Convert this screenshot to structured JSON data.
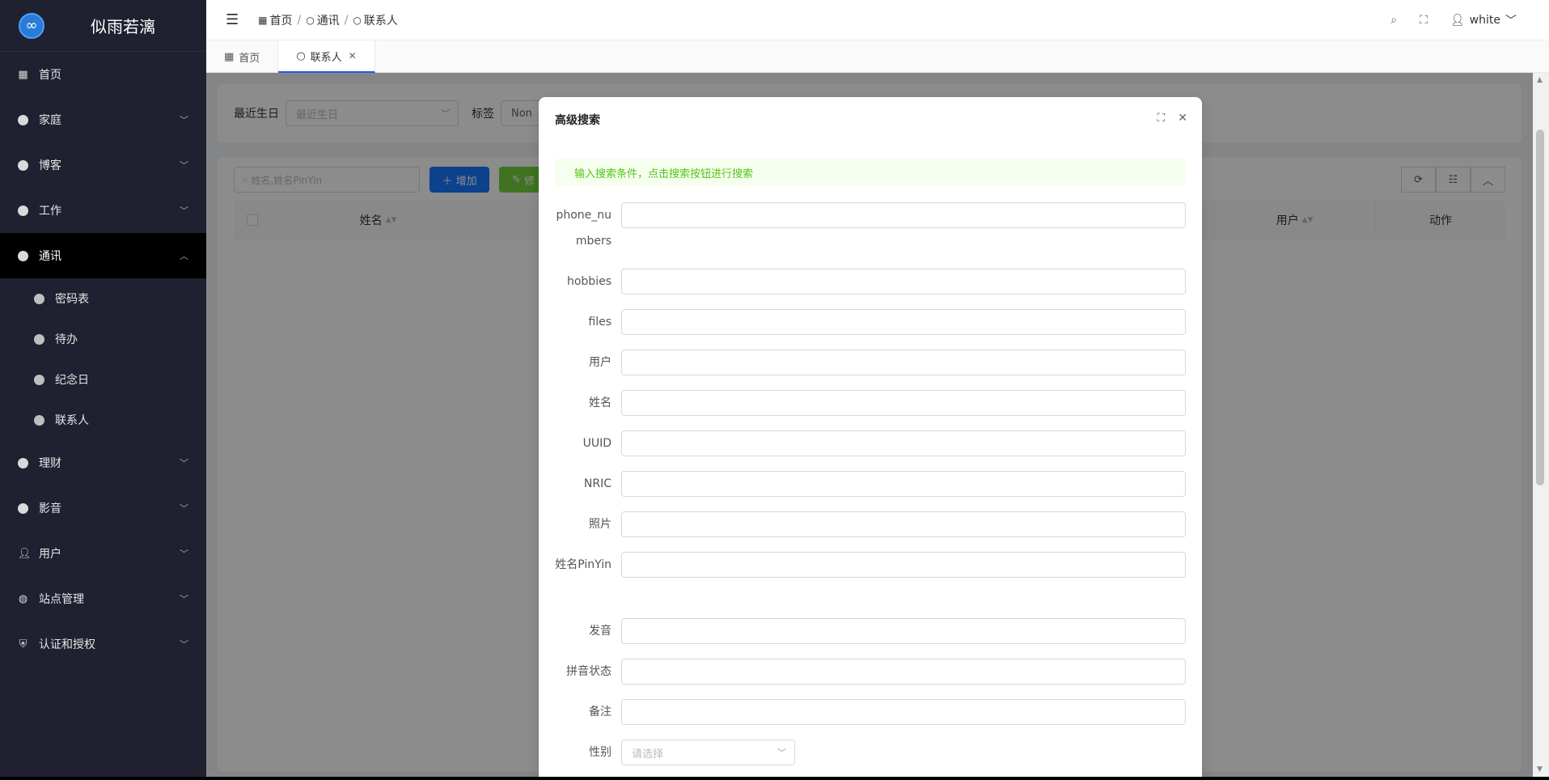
{
  "app": {
    "title": "似雨若漓",
    "logo_glyph": "∞"
  },
  "sidebar": {
    "items": [
      {
        "label": "首页",
        "icon": "grid-icon",
        "expandable": false
      },
      {
        "label": "家庭",
        "icon": "dot-icon",
        "expandable": true
      },
      {
        "label": "博客",
        "icon": "dot-icon",
        "expandable": true
      },
      {
        "label": "工作",
        "icon": "dot-icon",
        "expandable": true
      },
      {
        "label": "通讯",
        "icon": "dot-icon",
        "expandable": true,
        "active": true
      },
      {
        "label": "理财",
        "icon": "dot-icon",
        "expandable": true
      },
      {
        "label": "影音",
        "icon": "dot-icon",
        "expandable": true
      },
      {
        "label": "用户",
        "icon": "user-icon",
        "expandable": true
      },
      {
        "label": "站点管理",
        "icon": "globe-icon",
        "expandable": true
      },
      {
        "label": "认证和授权",
        "icon": "shield-icon",
        "expandable": true
      }
    ],
    "submenu": [
      {
        "label": "密码表"
      },
      {
        "label": "待办"
      },
      {
        "label": "纪念日"
      },
      {
        "label": "联系人"
      }
    ]
  },
  "header": {
    "breadcrumb": [
      "首页",
      "通讯",
      "联系人"
    ],
    "username": "white"
  },
  "tabs": [
    {
      "label": "首页",
      "active": false
    },
    {
      "label": "联系人",
      "active": true
    }
  ],
  "filters": {
    "birthday_label": "最近生日",
    "birthday_placeholder": "最近生日",
    "tag_label": "标签",
    "tag_value": "Non"
  },
  "table": {
    "search_placeholder": "姓名,姓名PinYin",
    "add_label": "增加",
    "edit_label": "修",
    "columns": [
      "姓名",
      "用户",
      "动作"
    ]
  },
  "modal": {
    "title": "高级搜索",
    "alert": "输入搜索条件，点击搜索按钮进行搜索",
    "fields": [
      {
        "label": "phone_numbers",
        "value": ""
      },
      {
        "label": "hobbies",
        "value": ""
      },
      {
        "label": "files",
        "value": ""
      },
      {
        "label": "用户",
        "value": ""
      },
      {
        "label": "姓名",
        "value": ""
      },
      {
        "label": "UUID",
        "value": ""
      },
      {
        "label": "NRIC",
        "value": ""
      },
      {
        "label": "照片",
        "value": ""
      },
      {
        "label": "姓名PinYin",
        "value": ""
      },
      {
        "label": "发音",
        "value": ""
      },
      {
        "label": "拼音状态",
        "value": ""
      },
      {
        "label": "备注",
        "value": ""
      }
    ],
    "gender_label": "性别",
    "gender_placeholder": "请选择"
  },
  "colors": {
    "sidebar_bg": "#1f2130",
    "primary": "#1677ff",
    "success_text": "#52c41a",
    "alert_bg": "#f6ffed"
  }
}
